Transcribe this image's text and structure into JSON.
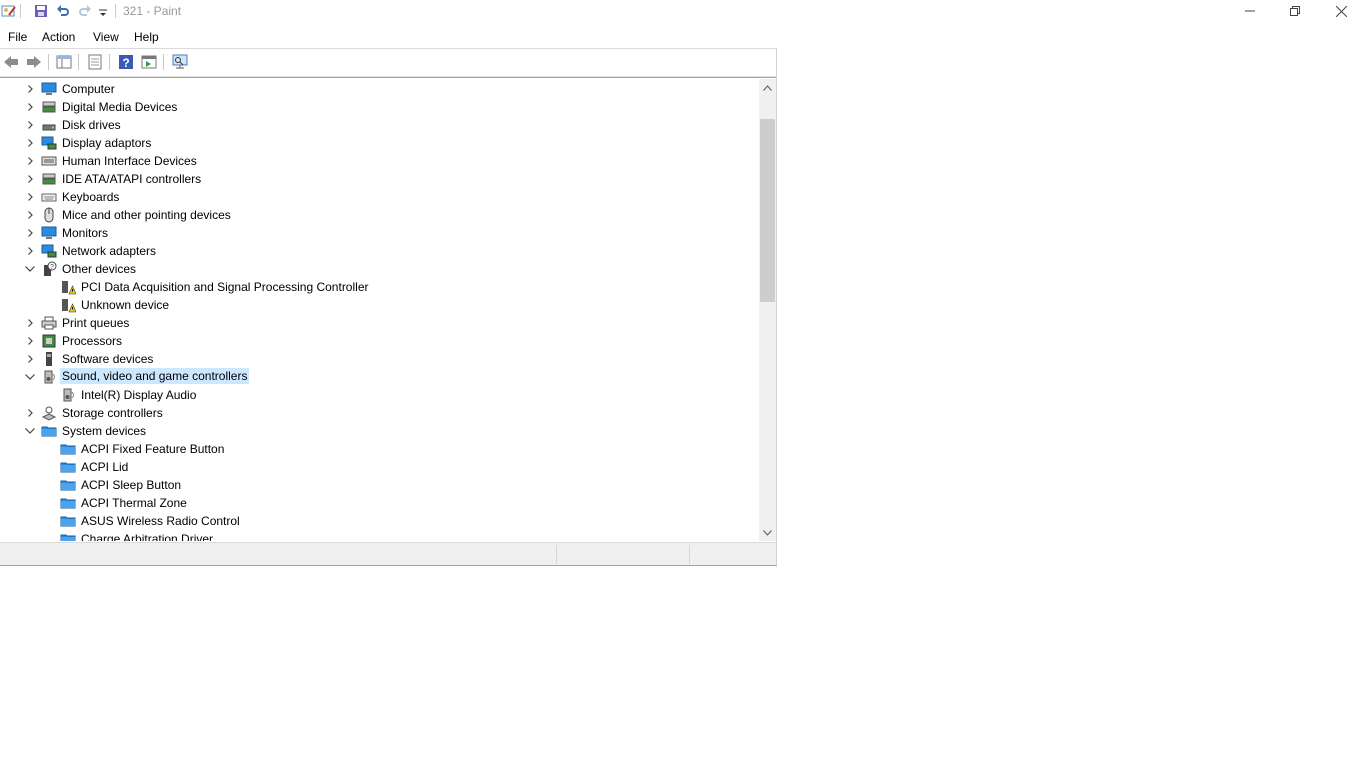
{
  "titlebar": {
    "title": "321 - Paint",
    "quick_access": [
      "paint-app-icon",
      "save-icon",
      "undo-icon",
      "redo-icon",
      "customize-quick-access-icon"
    ],
    "window_controls": [
      "minimize",
      "restore",
      "close"
    ]
  },
  "menu": {
    "items": [
      "File",
      "Action",
      "View",
      "Help"
    ]
  },
  "toolbar": {
    "buttons": [
      "back-arrow-icon",
      "forward-arrow-icon",
      "show-hide-console-tree-icon",
      "properties-icon",
      "help-icon",
      "update-driver-icon",
      "scan-hardware-changes-icon"
    ]
  },
  "tree": {
    "items": [
      {
        "label": "Computer",
        "state": "collapsed",
        "level": 0,
        "icon": "computer-icon"
      },
      {
        "label": "Digital Media Devices",
        "state": "collapsed",
        "level": 0,
        "icon": "media-device-icon"
      },
      {
        "label": "Disk drives",
        "state": "collapsed",
        "level": 0,
        "icon": "disk-drive-icon"
      },
      {
        "label": "Display adaptors",
        "state": "collapsed",
        "level": 0,
        "icon": "display-adapter-icon"
      },
      {
        "label": "Human Interface Devices",
        "state": "collapsed",
        "level": 0,
        "icon": "hid-icon"
      },
      {
        "label": "IDE ATA/ATAPI controllers",
        "state": "collapsed",
        "level": 0,
        "icon": "ide-controller-icon"
      },
      {
        "label": "Keyboards",
        "state": "collapsed",
        "level": 0,
        "icon": "keyboard-icon"
      },
      {
        "label": "Mice and other pointing devices",
        "state": "collapsed",
        "level": 0,
        "icon": "mouse-icon"
      },
      {
        "label": "Monitors",
        "state": "collapsed",
        "level": 0,
        "icon": "monitor-icon"
      },
      {
        "label": "Network adapters",
        "state": "collapsed",
        "level": 0,
        "icon": "network-adapter-icon"
      },
      {
        "label": "Other devices",
        "state": "expanded",
        "level": 0,
        "icon": "unknown-device-icon"
      },
      {
        "label": "PCI Data Acquisition and Signal Processing Controller",
        "state": "leaf",
        "level": 1,
        "icon": "warning-device-icon"
      },
      {
        "label": "Unknown device",
        "state": "leaf",
        "level": 1,
        "icon": "warning-device-icon"
      },
      {
        "label": "Print queues",
        "state": "collapsed",
        "level": 0,
        "icon": "printer-icon"
      },
      {
        "label": "Processors",
        "state": "collapsed",
        "level": 0,
        "icon": "processor-icon"
      },
      {
        "label": "Software devices",
        "state": "collapsed",
        "level": 0,
        "icon": "software-device-icon"
      },
      {
        "label": "Sound, video and game controllers",
        "state": "expanded",
        "level": 0,
        "icon": "speaker-icon",
        "selected": true
      },
      {
        "label": "Intel(R) Display Audio",
        "state": "leaf",
        "level": 1,
        "icon": "speaker-icon"
      },
      {
        "label": "Storage controllers",
        "state": "collapsed",
        "level": 0,
        "icon": "storage-controller-icon"
      },
      {
        "label": "System devices",
        "state": "expanded",
        "level": 0,
        "icon": "system-folder-icon"
      },
      {
        "label": "ACPI Fixed Feature Button",
        "state": "leaf",
        "level": 1,
        "icon": "system-folder-icon"
      },
      {
        "label": "ACPI Lid",
        "state": "leaf",
        "level": 1,
        "icon": "system-folder-icon"
      },
      {
        "label": "ACPI Sleep Button",
        "state": "leaf",
        "level": 1,
        "icon": "system-folder-icon"
      },
      {
        "label": "ACPI Thermal Zone",
        "state": "leaf",
        "level": 1,
        "icon": "system-folder-icon"
      },
      {
        "label": "ASUS Wireless Radio Control",
        "state": "leaf",
        "level": 1,
        "icon": "system-folder-icon"
      },
      {
        "label": "Charge Arbitration Driver",
        "state": "leaf",
        "level": 1,
        "icon": "system-folder-icon"
      }
    ]
  },
  "colors": {
    "selection": "#cce8ff",
    "scrollbar_track": "#f0f0f0",
    "scrollbar_thumb": "#cdcdcd",
    "title_text": "#999999"
  }
}
